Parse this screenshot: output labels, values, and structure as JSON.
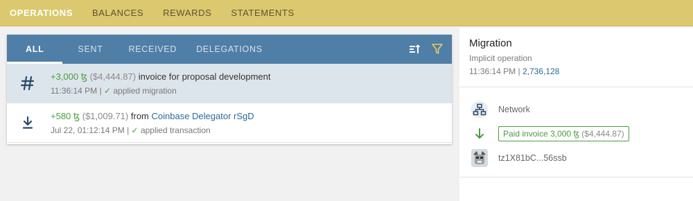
{
  "topnav": {
    "items": [
      {
        "label": "OPERATIONS"
      },
      {
        "label": "BALANCES"
      },
      {
        "label": "REWARDS"
      },
      {
        "label": "STATEMENTS"
      }
    ]
  },
  "tabs": {
    "all": "ALL",
    "sent": "SENT",
    "received": "RECEIVED",
    "delegations": "DELEGATIONS"
  },
  "operations": [
    {
      "amount": "+3,000 ꜩ",
      "fiat": "($4,444.87)",
      "description": "invoice for proposal development",
      "time": "11:36:14 PM",
      "status": "applied migration"
    },
    {
      "amount": "+580 ꜩ",
      "fiat": "($1,009.71)",
      "from_prefix": "from",
      "counterparty": "Coinbase Delegator rSgD",
      "time": "Jul 22, 01:12:14 PM",
      "status": "applied transaction"
    }
  ],
  "detail": {
    "title": "Migration",
    "subtitle": "Implicit operation",
    "time": "11:36:14 PM",
    "block": "2,736,128",
    "network_label": "Network",
    "paid_prefix": "Paid invoice",
    "paid_amount": "3,000 ꜩ",
    "paid_fiat": "($4,444.87)",
    "address": "tz1X81bC...56ssb"
  },
  "colors": {
    "topnav": "#dcc86e",
    "tabs": "#4f7ea6",
    "positive": "#4a9c3f",
    "link": "#2d6a98"
  }
}
